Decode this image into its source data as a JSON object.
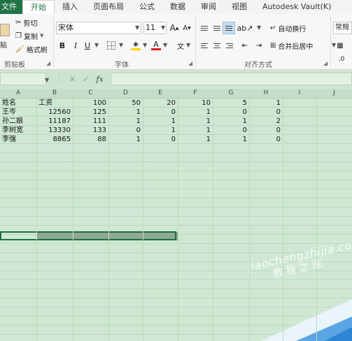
{
  "tabs": [
    "文件",
    "开始",
    "插入",
    "页面布局",
    "公式",
    "数据",
    "审阅",
    "视图",
    "Autodesk Vault(K)"
  ],
  "clipboard": {
    "paste": "贴",
    "cut": "剪切",
    "copy": "复制",
    "format_painter": "格式刷",
    "label": "剪贴板"
  },
  "font": {
    "name": "宋体",
    "size": "11",
    "label": "字体",
    "grow": "A",
    "shrink": "A",
    "bold": "B",
    "italic": "I",
    "underline": "U",
    "font_color": "A",
    "phonetic": "文"
  },
  "alignment": {
    "wrap": "自动换行",
    "merge": "合并后居中",
    "label": "对齐方式"
  },
  "number": {
    "format": "常规"
  },
  "formula_bar": {
    "fx": "fx",
    "cancel": "✕",
    "enter": "✓"
  },
  "columns": [
    "A",
    "B",
    "C",
    "D",
    "E",
    "F",
    "G",
    "H",
    "I",
    "J"
  ],
  "rows": [
    [
      "姓名",
      "工资",
      "100",
      "50",
      "20",
      "10",
      "5",
      "1"
    ],
    [
      "王岑",
      "12560",
      "125",
      "1",
      "0",
      "1",
      "0",
      "0"
    ],
    [
      "孙二娘",
      "11187",
      "111",
      "1",
      "1",
      "1",
      "1",
      "2"
    ],
    [
      "李树宽",
      "13330",
      "133",
      "0",
      "1",
      "1",
      "0",
      "0"
    ],
    [
      "李强",
      "8865",
      "88",
      "1",
      "0",
      "1",
      "1",
      "0"
    ]
  ],
  "watermark": {
    "line1": "jiaochengzhijia.com",
    "line2": "教程之家"
  }
}
